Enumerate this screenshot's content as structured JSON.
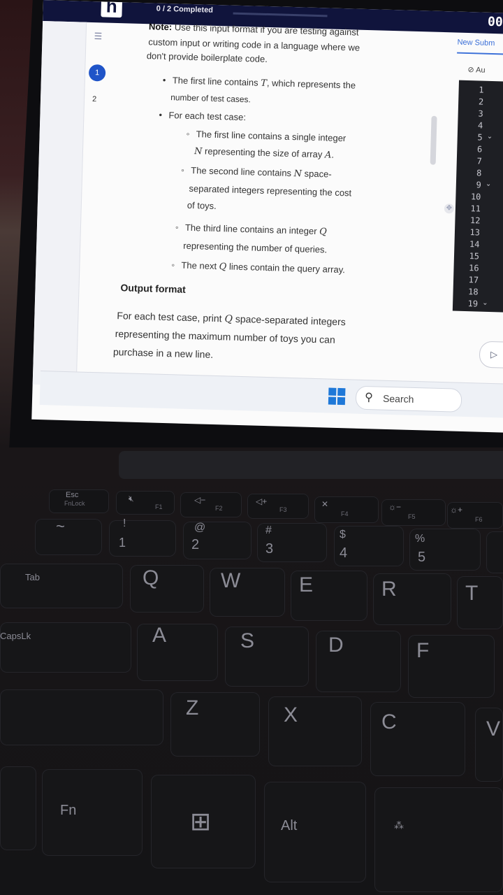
{
  "topbar": {
    "logo_letter": "h",
    "progress_text": "0 / 2 Completed",
    "progress_fraction": 0,
    "timer": "00 :"
  },
  "sidebar": {
    "question_one": "1",
    "question_two": "2"
  },
  "problem": {
    "note_label": "Note:",
    "note_line1": "Use this input format if you are testing against",
    "note_line2": "custom input or writing code in a language where we",
    "note_line3": "don't provide boilerplate code.",
    "bullet1_line1": "The first line contains",
    "var_T": "T",
    "bullet1_line1_end": ", which represents the",
    "bullet1_line2": "number of test cases.",
    "bullet2": "For each test case:",
    "sub1_line1": "The first line contains a single integer",
    "var_N": "N",
    "sub1_line2": "representing the size of array",
    "var_A": "A",
    "period": ".",
    "sub2_line1": "The second line contains",
    "sub2_line1_end": "space-",
    "sub2_line2": "separated integers representing the cost",
    "sub2_line3": "of toys.",
    "sub3_line1": "The third line contains an integer",
    "var_Q": "Q",
    "sub3_line2": "representing the number of queries.",
    "sub4_start": "The next",
    "sub4_end": "lines contain the query array.",
    "output_heading": "Output format",
    "out_line1_start": "For each test case, print",
    "out_line1_end": "space-separated integers",
    "out_line2": "representing the maximum number of toys you can",
    "out_line3": "purchase in a new line."
  },
  "editor": {
    "tab_label": "New Subm",
    "auto_label": "Au",
    "line_numbers": [
      "1",
      "2",
      "3",
      "4",
      "5",
      "6",
      "7",
      "8",
      "9",
      "10",
      "11",
      "12",
      "13",
      "14",
      "15",
      "16",
      "17",
      "18",
      "19"
    ]
  },
  "taskbar": {
    "search_label": "Search"
  },
  "keyboard": {
    "esc": "Esc",
    "esc_sub": "FnLock",
    "f1": "F1",
    "f2": "F2",
    "f3": "F3",
    "f4": "F4",
    "f5": "F5",
    "f6": "F6",
    "tilde": "~",
    "k1_top": "!",
    "k1": "1",
    "k2_top": "@",
    "k2": "2",
    "k3_top": "#",
    "k3": "3",
    "k4_top": "$",
    "k4": "4",
    "k5_top": "%",
    "k5": "5",
    "tab": "Tab",
    "q": "Q",
    "w": "W",
    "e": "E",
    "r": "R",
    "t": "T",
    "caps": "CapsLk",
    "a": "A",
    "s": "S",
    "d": "D",
    "f": "F",
    "z": "Z",
    "x": "X",
    "c": "C",
    "v": "V",
    "fn": "Fn",
    "alt": "Alt"
  },
  "colors": {
    "topbar": "#10143c",
    "accent": "#1f54c8",
    "windows_blue": "#1e78d8"
  }
}
